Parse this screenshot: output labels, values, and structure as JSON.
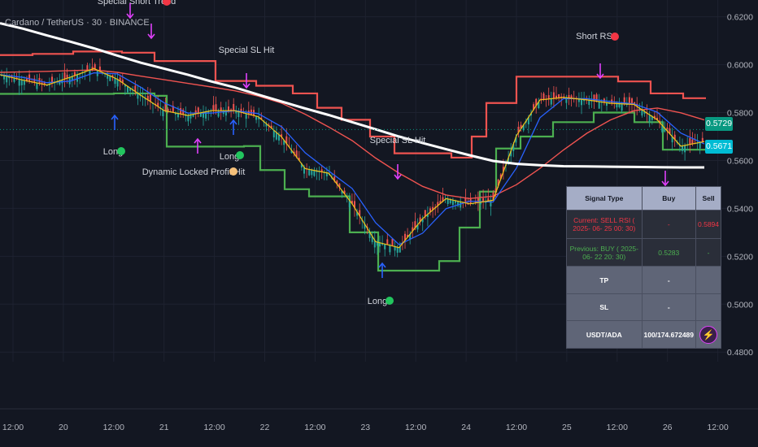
{
  "chart_title": "Cardano / TetherUS · 30 · BINANCE",
  "price_badges": {
    "last": {
      "value": "0.5729",
      "color": "#089981"
    },
    "ma": {
      "value": "0.5671",
      "color": "#00bcd4"
    }
  },
  "table": {
    "headers": [
      "Signal Type",
      "Buy",
      "Sell"
    ],
    "rows": [
      {
        "type": "Current: SELL RSI ( 2025- 06- 25  00: 30)",
        "buy": "-",
        "sell": "0.5894"
      },
      {
        "type": "Previous: BUY ( 2025- 06- 22  20: 30)",
        "buy": "0.5283",
        "sell": "-"
      },
      {
        "type": "TP",
        "buy": "-",
        "sell": ""
      },
      {
        "type": "SL",
        "buy": "-",
        "sell": ""
      },
      {
        "type": "USDT/ADA",
        "buy": "100/174.672489",
        "sell": ""
      }
    ],
    "icon": "lightning-icon"
  },
  "signal_labels": [
    {
      "text": "Special Short Trend",
      "icon": "short-signal-dot"
    },
    {
      "text": "Special SL Hit",
      "icon": "arrow-down-icon"
    },
    {
      "text": "Special SL Hit",
      "icon": "arrow-down-icon"
    },
    {
      "text": "Short RSI",
      "icon": "short-signal-dot"
    },
    {
      "text": "Long",
      "icon": "long-signal-dot"
    },
    {
      "text": "Long",
      "icon": "long-signal-dot"
    },
    {
      "text": "Long",
      "icon": "long-signal-dot"
    },
    {
      "text": "Dynamic Locked Profit Hit",
      "icon": "profit-coin-icon"
    },
    {
      "text": "Dynamic Locked Profit Hit",
      "icon": "profit-coin-icon"
    }
  ],
  "chart_data": {
    "type": "line",
    "title": "Cardano / TetherUS · 30 · BINANCE",
    "y_ticks": [
      "0.6200",
      "0.6000",
      "0.5800",
      "0.5600",
      "0.5400",
      "0.5200",
      "0.5000",
      "0.4800"
    ],
    "x_ticks": [
      "12:00",
      "20",
      "12:00",
      "21",
      "12:00",
      "22",
      "12:00",
      "23",
      "12:00",
      "24",
      "12:00",
      "25",
      "12:00",
      "26",
      "12:00"
    ],
    "ylim": [
      0.476,
      0.627
    ],
    "colors": {
      "price": "#f0c419",
      "ma_fast": "#2962ff",
      "ma_mid": "#ef5350",
      "ma_long": "#ffffff",
      "stop_short": "#ef5350",
      "stop_long": "#4caf50"
    },
    "x": [
      0,
      12,
      24,
      36,
      48,
      60,
      72,
      84,
      96,
      108,
      120,
      132,
      144,
      156,
      168
    ],
    "series": [
      {
        "key": "price",
        "values": [
          0.5958,
          0.5935,
          0.5915,
          0.5948,
          0.5984,
          0.5939,
          0.5872,
          0.5808,
          0.5788,
          0.5808,
          0.5808,
          0.5783,
          0.5698,
          0.5566,
          0.5547,
          0.5419,
          0.5261,
          0.5236,
          0.5357,
          0.5441,
          0.5419,
          0.5434,
          0.5704,
          0.5853,
          0.5863,
          0.5853,
          0.5839,
          0.5834,
          0.5769,
          0.566,
          0.5679
        ]
      },
      {
        "key": "ma_long",
        "values": [
          0.6173,
          0.615,
          0.6122,
          0.6096,
          0.6068,
          0.6038,
          0.6008,
          0.5983,
          0.5958,
          0.593,
          0.5905,
          0.5875,
          0.5846,
          0.5817,
          0.579,
          0.576,
          0.573,
          0.57,
          0.5673,
          0.5647,
          0.5622,
          0.5598,
          0.5586,
          0.558,
          0.5576,
          0.5575,
          0.5574,
          0.5573,
          0.5572,
          0.5571,
          0.5571
        ]
      },
      {
        "key": "ma_mid",
        "values": [
          0.5968,
          0.597,
          0.5972,
          0.5975,
          0.5978,
          0.5968,
          0.5952,
          0.5937,
          0.5922,
          0.5907,
          0.5891,
          0.5869,
          0.5839,
          0.5793,
          0.574,
          0.5683,
          0.561,
          0.5547,
          0.5492,
          0.5456,
          0.5441,
          0.5451,
          0.5499,
          0.5567,
          0.5644,
          0.5714,
          0.5769,
          0.5808,
          0.5819,
          0.5799,
          0.5769
        ]
      }
    ]
  }
}
